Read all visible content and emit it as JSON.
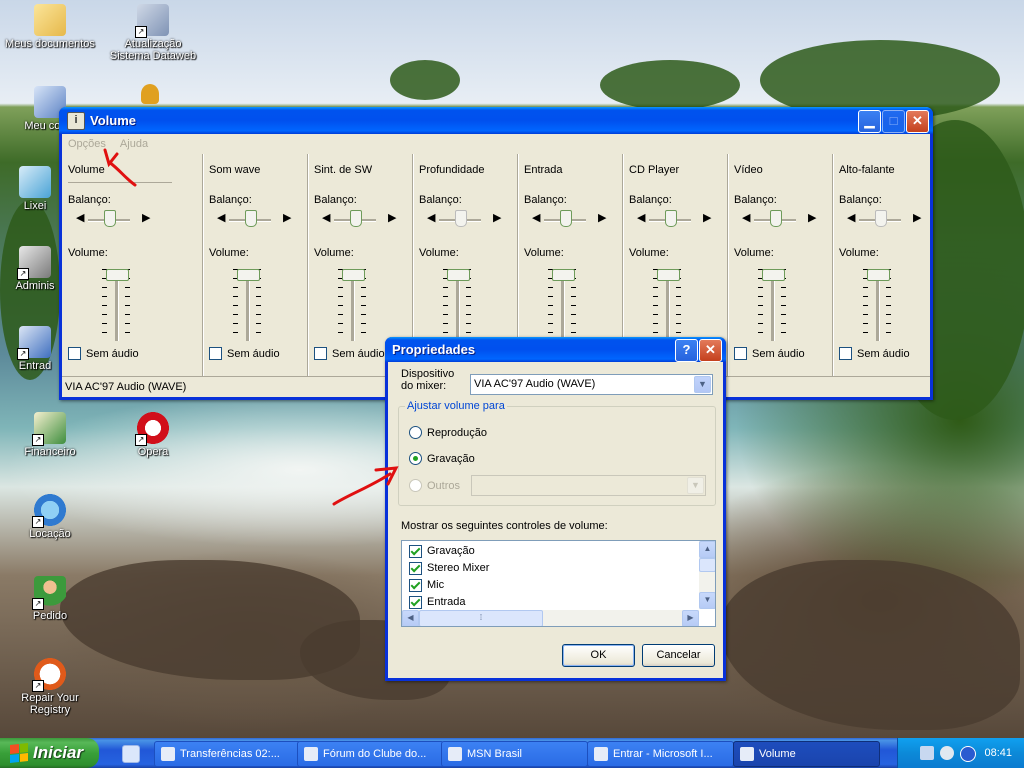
{
  "desktop": {
    "icons": [
      {
        "label": "Meus documentos"
      },
      {
        "label": "Atualização Sistema Dataweb"
      },
      {
        "label": "Meu comp"
      },
      {
        "label": "Lixei"
      },
      {
        "label": "Adminis"
      },
      {
        "label": "Entrad"
      },
      {
        "label": "Financeiro"
      },
      {
        "label": "Opera"
      },
      {
        "label": "Locação"
      },
      {
        "label": "Pedido"
      },
      {
        "label": "Repair Your Registry"
      }
    ]
  },
  "volume_window": {
    "title": "Volume",
    "menu": [
      "Opções",
      "Ajuda"
    ],
    "balance_label": "Balanço:",
    "volume_label": "Volume:",
    "mute_label": "Sem áudio",
    "channels": [
      {
        "name": "Volume",
        "balance": 0.5,
        "level": 0.0,
        "muted": false,
        "enabled": true
      },
      {
        "name": "Som wave",
        "balance": 0.5,
        "level": 0.0,
        "muted": false,
        "enabled": true
      },
      {
        "name": "Sint. de SW",
        "balance": 0.5,
        "level": 0.0,
        "muted": false,
        "enabled": true
      },
      {
        "name": "Profundidade",
        "balance": 0.5,
        "level": 0.0,
        "muted": false,
        "enabled": false
      },
      {
        "name": "Entrada",
        "balance": 0.5,
        "level": 0.0,
        "muted": false,
        "enabled": true
      },
      {
        "name": "CD Player",
        "balance": 0.5,
        "level": 0.0,
        "muted": false,
        "enabled": true
      },
      {
        "name": "Vídeo",
        "balance": 0.5,
        "level": 0.0,
        "muted": false,
        "enabled": true
      },
      {
        "name": "Alto-falante",
        "balance": 0.5,
        "level": 0.0,
        "muted": false,
        "enabled": false
      }
    ],
    "status": "VIA AC'97 Audio (WAVE)"
  },
  "properties_dialog": {
    "title": "Propriedades",
    "help_button": "?",
    "mixer_device_label": "Dispositivo do mixer:",
    "mixer_device_value": "VIA AC'97 Audio (WAVE)",
    "adjust_group_title": "Ajustar volume para",
    "options": [
      {
        "label": "Reprodução",
        "selected": false,
        "enabled": true
      },
      {
        "label": "Gravação",
        "selected": true,
        "enabled": true
      },
      {
        "label": "Outros",
        "selected": false,
        "enabled": false
      }
    ],
    "controls_label": "Mostrar os seguintes controles de volume:",
    "controls": [
      {
        "label": "Gravação",
        "checked": true
      },
      {
        "label": "Stereo Mixer",
        "checked": true
      },
      {
        "label": "Mic",
        "checked": true
      },
      {
        "label": "Entrada",
        "checked": true
      }
    ],
    "ok_label": "OK",
    "cancel_label": "Cancelar"
  },
  "taskbar": {
    "start_label": "Iniciar",
    "tasks": [
      {
        "label": "Transferências 02:...",
        "active": false
      },
      {
        "label": "Fórum do Clube do...",
        "active": false
      },
      {
        "label": "MSN Brasil",
        "active": false
      },
      {
        "label": "Entrar - Microsoft I...",
        "active": false
      },
      {
        "label": "Volume",
        "active": true
      }
    ],
    "clock": "08:41"
  },
  "colors": {
    "title_bar": "#0053ee",
    "window_face": "#ece9d8",
    "start_green": "#39a039",
    "annotation_red": "#e01010"
  }
}
